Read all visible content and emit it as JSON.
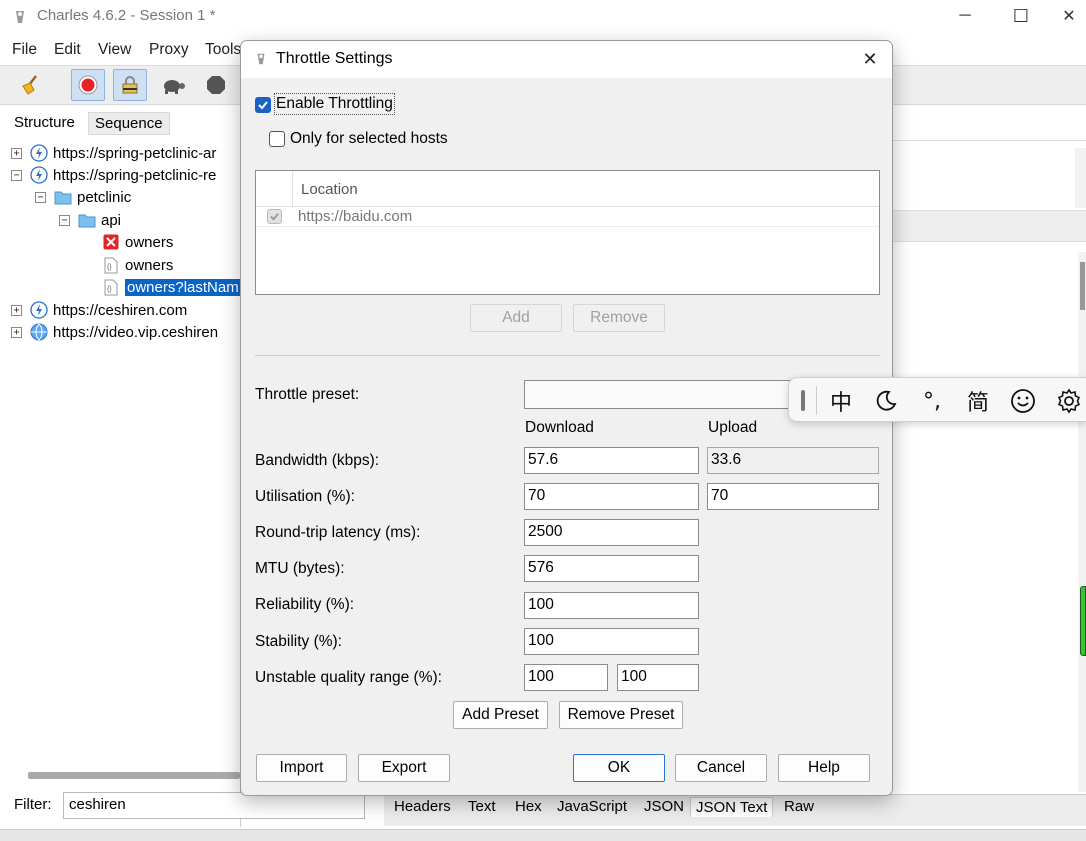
{
  "window": {
    "title": "Charles 4.6.2 - Session 1 *",
    "controls": {
      "minimize": "─",
      "maximize": "☐",
      "close": "✕"
    }
  },
  "menubar": {
    "items": [
      "File",
      "Edit",
      "View",
      "Proxy",
      "Tools"
    ]
  },
  "toolbar": {
    "buttons": [
      "broom-icon",
      "record-icon",
      "ssl-proxy-icon",
      "throttle-turtle-icon",
      "breakpoint-stop-icon"
    ]
  },
  "left_panel": {
    "tabs": {
      "structure": "Structure",
      "sequence": "Sequence"
    },
    "tree": [
      {
        "label": "https://spring-petclinic-ar",
        "expander": "+"
      },
      {
        "label": "https://spring-petclinic-re",
        "expander": "−"
      },
      {
        "label": "petclinic",
        "expander": "−"
      },
      {
        "label": "api",
        "expander": "−"
      },
      {
        "label": "owners"
      },
      {
        "label": "owners"
      },
      {
        "label": "owners?lastNam"
      },
      {
        "label": "https://ceshiren.com",
        "expander": "+"
      },
      {
        "label": "https://video.vip.ceshiren",
        "expander": "+"
      }
    ],
    "filter": {
      "label": "Filter:",
      "value": "ceshiren"
    }
  },
  "bottom_tabs": [
    "Headers",
    "Text",
    "Hex",
    "JavaScript",
    "JSON",
    "JSON Text",
    "Raw"
  ],
  "dialog": {
    "title": "Throttle Settings",
    "close": "✕",
    "enable_throttling": {
      "label": "Enable Throttling",
      "checked": true
    },
    "only_selected_hosts": {
      "label": "Only for selected hosts",
      "checked": false
    },
    "hosts_table": {
      "column": "Location",
      "rows": [
        {
          "enabled": true,
          "location": "https://baidu.com"
        }
      ]
    },
    "add_label": "Add",
    "remove_label": "Remove",
    "preset": {
      "label": "Throttle preset:",
      "value": ""
    },
    "columns": {
      "download": "Download",
      "upload": "Upload"
    },
    "fields": {
      "bandwidth": {
        "label": "Bandwidth (kbps):",
        "download": "57.6",
        "upload": "33.6"
      },
      "utilisation": {
        "label": "Utilisation (%):",
        "download": "70",
        "upload": "70"
      },
      "latency": {
        "label": "Round-trip latency (ms):",
        "value": "2500"
      },
      "mtu": {
        "label": "MTU (bytes):",
        "value": "576"
      },
      "reliability": {
        "label": "Reliability (%):",
        "value": "100"
      },
      "stability": {
        "label": "Stability (%):",
        "value": "100"
      },
      "unstable": {
        "label": "Unstable quality range (%):",
        "min": "100",
        "max": "100"
      }
    },
    "add_preset_label": "Add Preset",
    "remove_preset_label": "Remove Preset",
    "import_label": "Import",
    "export_label": "Export",
    "ok_label": "OK",
    "cancel_label": "Cancel",
    "help_label": "Help"
  },
  "ime_toolbar": {
    "chinese_mode": "中",
    "punctuation": "°,",
    "simplified": "简"
  },
  "colors": {
    "accent": "#1a63c4",
    "selection": "#0a64c8",
    "record_red": "#e8202a"
  }
}
